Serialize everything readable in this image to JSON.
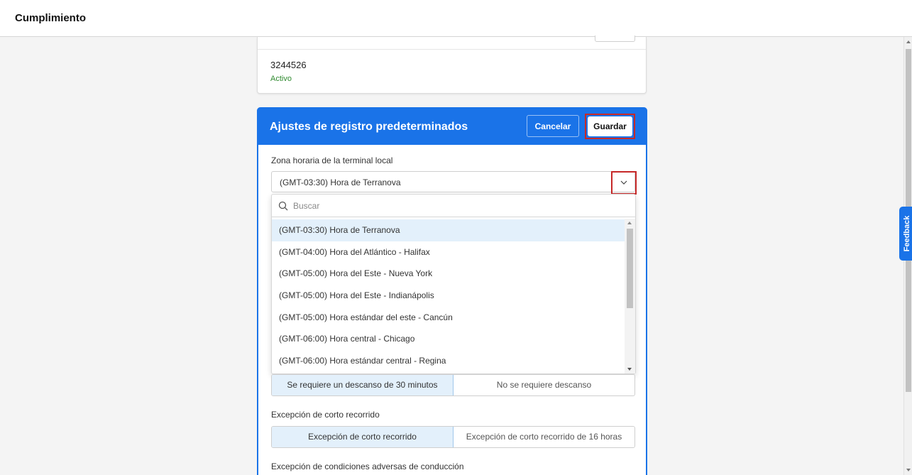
{
  "header": {
    "title": "Cumplimiento"
  },
  "vehicle_card": {
    "number": "3244526",
    "status": "Activo"
  },
  "panel": {
    "title": "Ajustes de registro predeterminados",
    "cancel_label": "Cancelar",
    "save_label": "Guardar"
  },
  "timezone": {
    "label": "Zona horaria de la terminal local",
    "selected": "(GMT-03:30) Hora de Terranova",
    "search_placeholder": "Buscar",
    "options": [
      "(GMT-03:30) Hora de Terranova",
      "(GMT-04:00) Hora del Atlántico - Halifax",
      "(GMT-05:00) Hora del Este - Nueva York",
      "(GMT-05:00) Hora del Este - Indianápolis",
      "(GMT-05:00) Hora estándar del este - Cancún",
      "(GMT-06:00) Hora central - Chicago",
      "(GMT-06:00) Hora estándar central - Regina"
    ]
  },
  "rest_break": {
    "options": [
      "Se requiere un descanso de 30 minutos",
      "No se requiere descanso"
    ]
  },
  "short_haul": {
    "label": "Excepción de corto recorrido",
    "options": [
      "Excepción de corto recorrido",
      "Excepción de corto recorrido de 16 horas"
    ]
  },
  "adverse": {
    "label": "Excepción de condiciones adversas de conducción"
  },
  "feedback": {
    "label": "Feedback"
  },
  "colors": {
    "accent": "#1a73e8",
    "highlight": "#c62828",
    "active_status": "#2f8a2f"
  }
}
